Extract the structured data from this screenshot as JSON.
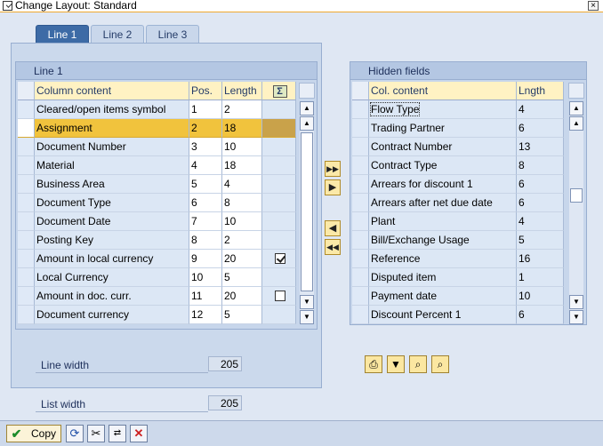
{
  "window": {
    "title": "Change Layout: Standard",
    "close_glyph": "×"
  },
  "tabs": [
    {
      "label": "Line 1",
      "active": true
    },
    {
      "label": "Line 2",
      "active": false
    },
    {
      "label": "Line 3",
      "active": false
    }
  ],
  "left_panel": {
    "title": "Line 1",
    "headers": {
      "content": "Column content",
      "pos": "Pos.",
      "length": "Length"
    },
    "rows": [
      {
        "content": "Cleared/open items symbol",
        "pos": "1",
        "length": "2",
        "checkbox": "none"
      },
      {
        "content": "Assignment",
        "pos": "2",
        "length": "18",
        "checkbox": "none",
        "highlighted": true
      },
      {
        "content": "Document Number",
        "pos": "3",
        "length": "10",
        "checkbox": "none"
      },
      {
        "content": "Material",
        "pos": "4",
        "length": "18",
        "checkbox": "none"
      },
      {
        "content": "Business Area",
        "pos": "5",
        "length": "4",
        "checkbox": "none"
      },
      {
        "content": "Document Type",
        "pos": "6",
        "length": "8",
        "checkbox": "none"
      },
      {
        "content": "Document Date",
        "pos": "7",
        "length": "10",
        "checkbox": "none"
      },
      {
        "content": "Posting Key",
        "pos": "8",
        "length": "2",
        "checkbox": "none"
      },
      {
        "content": "Amount in local currency",
        "pos": "9",
        "length": "20",
        "checkbox": "checked"
      },
      {
        "content": "Local Currency",
        "pos": "10",
        "length": "5",
        "checkbox": "none"
      },
      {
        "content": "Amount in doc. curr.",
        "pos": "11",
        "length": "20",
        "checkbox": "unchecked"
      },
      {
        "content": "Document currency",
        "pos": "12",
        "length": "5",
        "checkbox": "none"
      }
    ],
    "line_width_label": "Line width",
    "line_width_value": "205"
  },
  "list_width": {
    "label": "List width",
    "value": "205"
  },
  "right_panel": {
    "title": "Hidden fields",
    "headers": {
      "content": "Col. content",
      "length": "Lngth"
    },
    "rows": [
      {
        "content": "Flow Type",
        "length": "4"
      },
      {
        "content": "Trading Partner",
        "length": "6"
      },
      {
        "content": "Contract Number",
        "length": "13"
      },
      {
        "content": "Contract Type",
        "length": "8"
      },
      {
        "content": "Arrears for discount 1",
        "length": "6"
      },
      {
        "content": "Arrears after net due date",
        "length": "6"
      },
      {
        "content": "Plant",
        "length": "4"
      },
      {
        "content": "Bill/Exchange Usage",
        "length": "5"
      },
      {
        "content": "Reference",
        "length": "16"
      },
      {
        "content": "Disputed item",
        "length": "1"
      },
      {
        "content": "Payment date",
        "length": "10"
      },
      {
        "content": "Discount Percent 1",
        "length": "6"
      }
    ]
  },
  "move_buttons": [
    {
      "name": "move-all-right-button",
      "glyph": "▶▶"
    },
    {
      "name": "move-right-button",
      "glyph": "▶"
    },
    {
      "name": "move-left-button",
      "glyph": "◀"
    },
    {
      "name": "move-all-left-button",
      "glyph": "◀◀"
    }
  ],
  "toolbar_icons": [
    "print-icon",
    "filter-icon",
    "find-icon",
    "find-next-icon"
  ],
  "bottom_bar": {
    "copy_label": "Copy",
    "icons": [
      "refresh-icon",
      "cut-icon",
      "transfer-icon",
      "cancel-icon"
    ]
  },
  "colors": {
    "highlight": "#f1c33d",
    "active_tab": "#3d6ba6",
    "column_header": "#fff2c3",
    "cancel": "#cc1f1f",
    "confirm": "#1b8b2a"
  }
}
